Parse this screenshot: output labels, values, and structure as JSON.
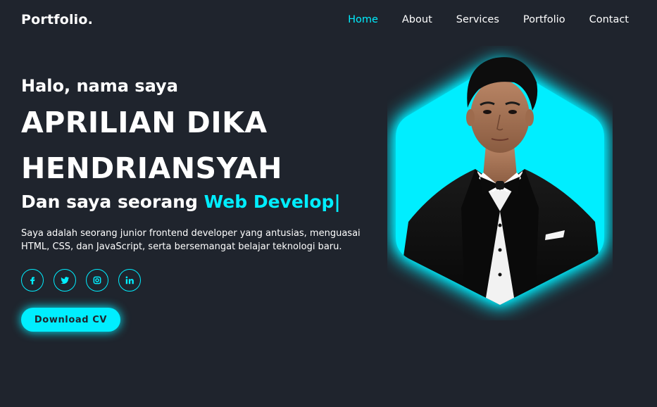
{
  "header": {
    "logo": "Portfolio.",
    "nav": [
      "Home",
      "About",
      "Services",
      "Portfolio",
      "Contact"
    ],
    "active_nav": "Home"
  },
  "hero": {
    "greeting": "Halo, nama saya",
    "name_line1": "APRILIAN DIKA",
    "name_line2": "HENDRIANSYAH",
    "role_prefix": "Dan saya seorang",
    "role_typed": "Web Develop|",
    "description": "Saya adalah seorang junior frontend developer yang antusias, menguasai HTML, CSS, dan JavaScript, serta bersemangat belajar teknologi baru.",
    "download_label": "Download CV"
  },
  "social": [
    {
      "icon": "facebook-icon"
    },
    {
      "icon": "twitter-icon"
    },
    {
      "icon": "instagram-icon"
    },
    {
      "icon": "linkedin-icon"
    }
  ],
  "colors": {
    "background": "#1f242d",
    "accent": "#00eeff",
    "text": "#ffffff"
  },
  "image": {
    "subject": "portrait-photo"
  }
}
